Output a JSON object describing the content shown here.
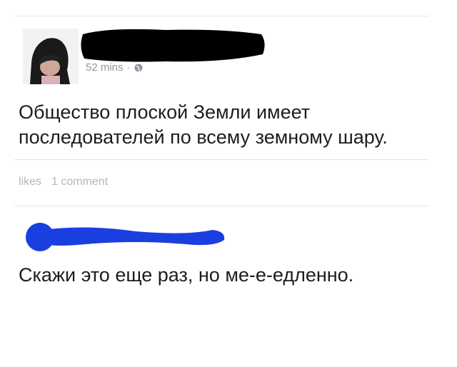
{
  "post": {
    "timestamp": "52 mins",
    "separator": "·",
    "privacy_icon": "globe-icon",
    "text_lines": [
      "Общество плоской Земли имеет",
      "последователей по всему земному шару."
    ],
    "likes_label": "likes",
    "comments_label": "1 comment"
  },
  "comment": {
    "text": "Скажи это еще раз, но ме-е-едленно."
  },
  "colors": {
    "redaction_black": "#000000",
    "redaction_blue": "#1a3fe0",
    "meta_gray": "#9197a3"
  }
}
